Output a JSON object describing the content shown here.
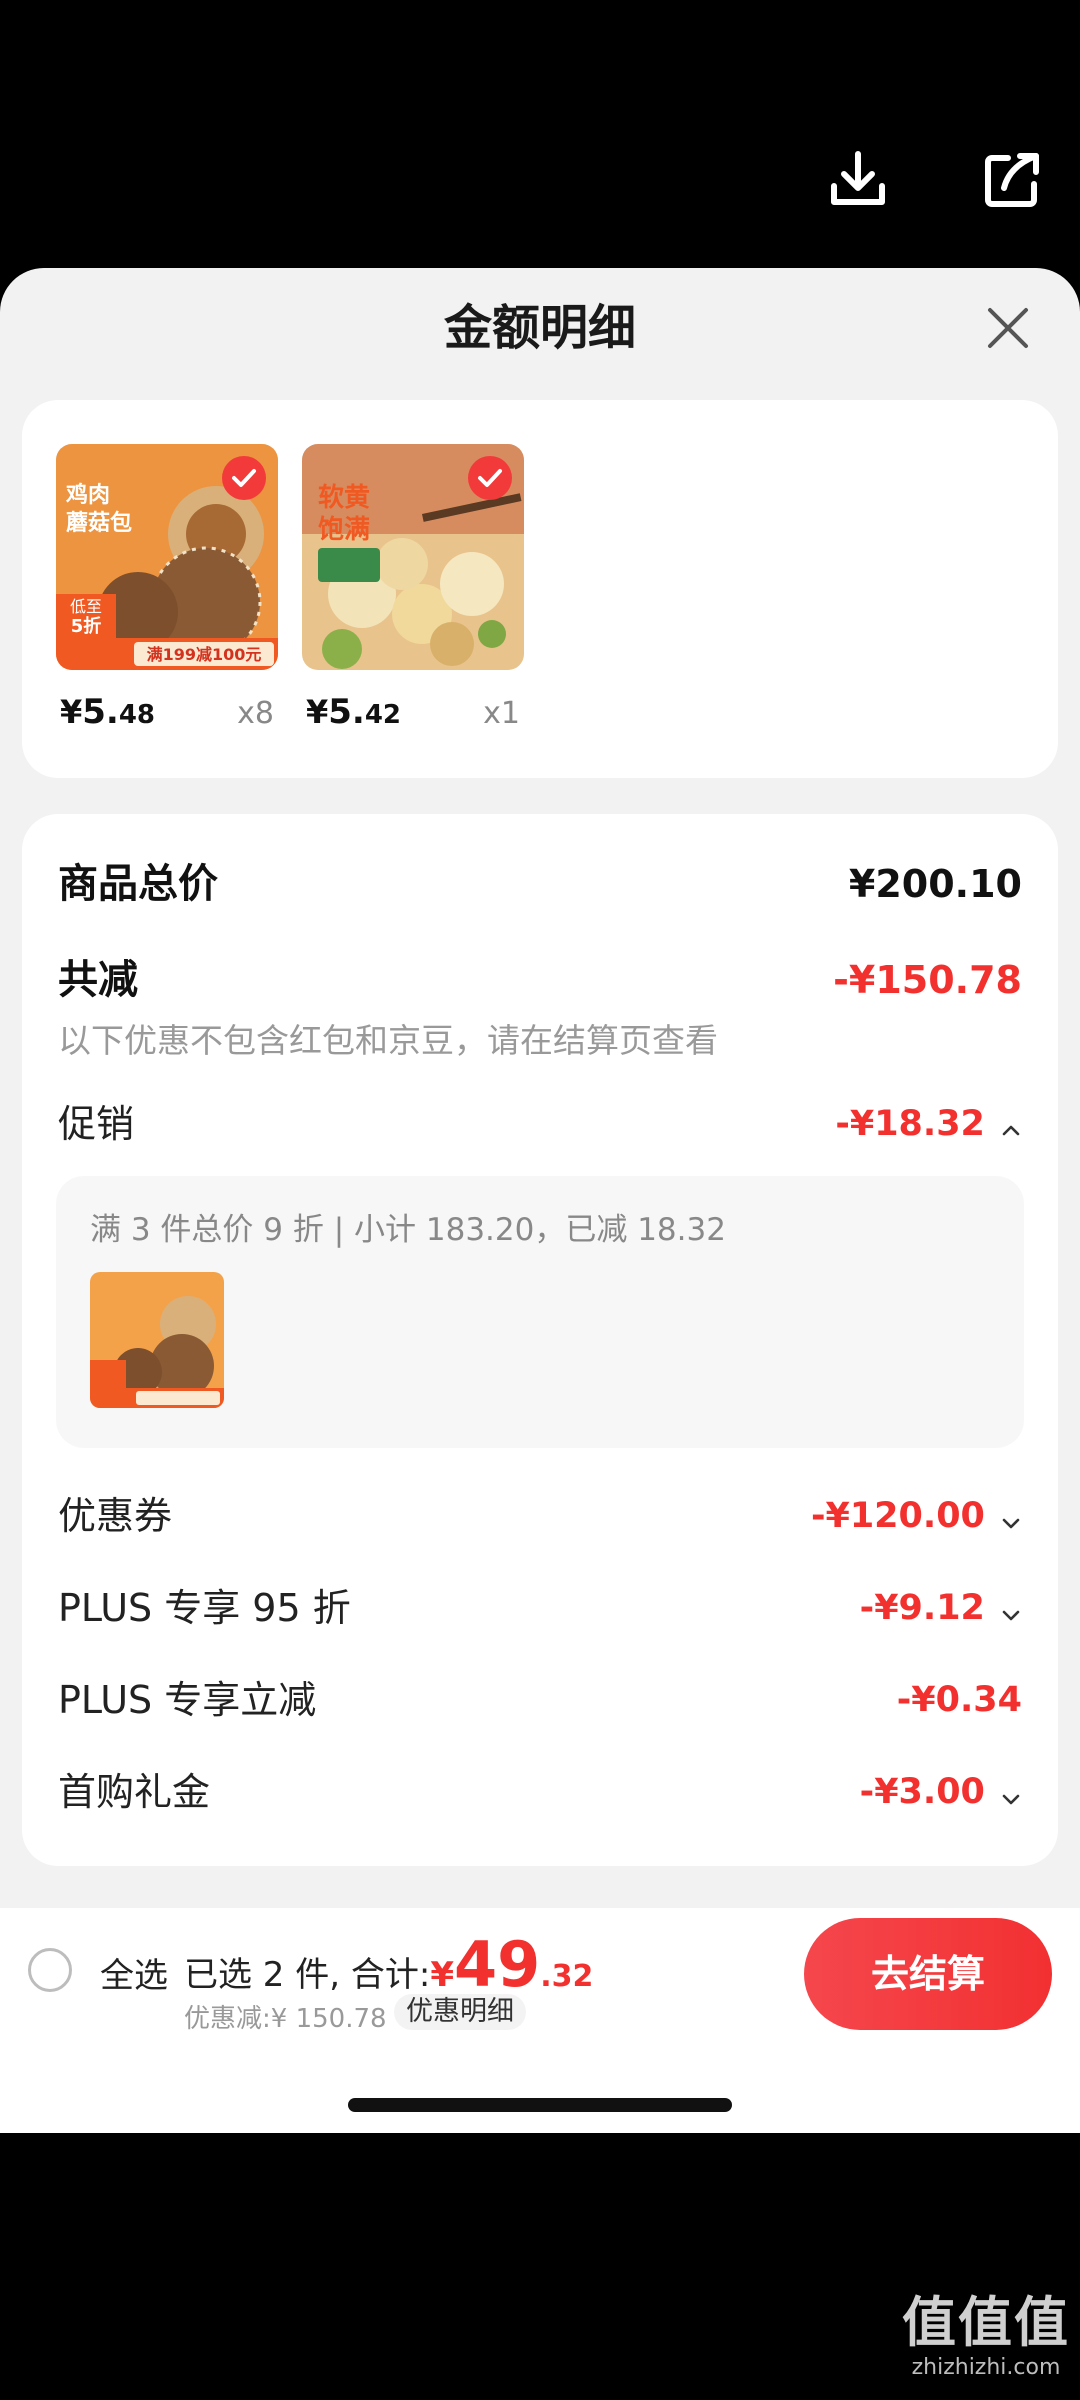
{
  "top_actions": [
    {
      "icon": "download-icon"
    },
    {
      "icon": "share-icon"
    }
  ],
  "sheet": {
    "title": "金额明细",
    "close_icon": "close-icon"
  },
  "products": [
    {
      "image": "chicken-mushroom-bun-product-image",
      "image_text": [
        "鸡肉",
        "蘑菇包",
        "低至",
        "5折",
        "满199减100元"
      ],
      "selected": true,
      "price_currency": "¥",
      "price_int": "5.",
      "price_dec": "48",
      "qty": "x8"
    },
    {
      "image": "scallop-product-image",
      "image_text": [
        "软黄",
        "饱满"
      ],
      "selected": true,
      "price_currency": "¥",
      "price_int": "5.",
      "price_dec": "42",
      "qty": "x1"
    }
  ],
  "summary": {
    "goods_total_label": "商品总价",
    "goods_total_value": "¥200.10",
    "total_reduce_label": "共减",
    "total_reduce_value": "-¥150.78",
    "note": "以下优惠不包含红包和京豆，请在结算页查看",
    "promotion_label": "促销",
    "promotion_value": "-¥18.32",
    "promotion_detail": "满 3 件总价 9 折 | 小计 183.20，已减 18.32",
    "coupon_label": "优惠券",
    "coupon_value": "-¥120.00",
    "plus95_label": "PLUS 专享 95 折",
    "plus95_value": "-¥9.12",
    "plus_instant_label": "PLUS 专享立减",
    "plus_instant_value": "-¥0.34",
    "first_gift_label": "首购礼金",
    "first_gift_value": "-¥3.00"
  },
  "bottom_bar": {
    "select_all_label": "全选",
    "selected_text": "已选 2 件, 合计:",
    "total_currency": "¥",
    "total_int": "49",
    "total_dec": ".32",
    "saved_text": "优惠减:¥ 150.78",
    "detail_chip": "优惠明细",
    "checkout_label": "去结算"
  },
  "watermark": {
    "logo": "值值值",
    "domain": "zhizhizhi.com"
  },
  "colors": {
    "accent_red": "#f2312f",
    "sheet_bg": "#f2f2f2",
    "card_bg": "#ffffff"
  }
}
